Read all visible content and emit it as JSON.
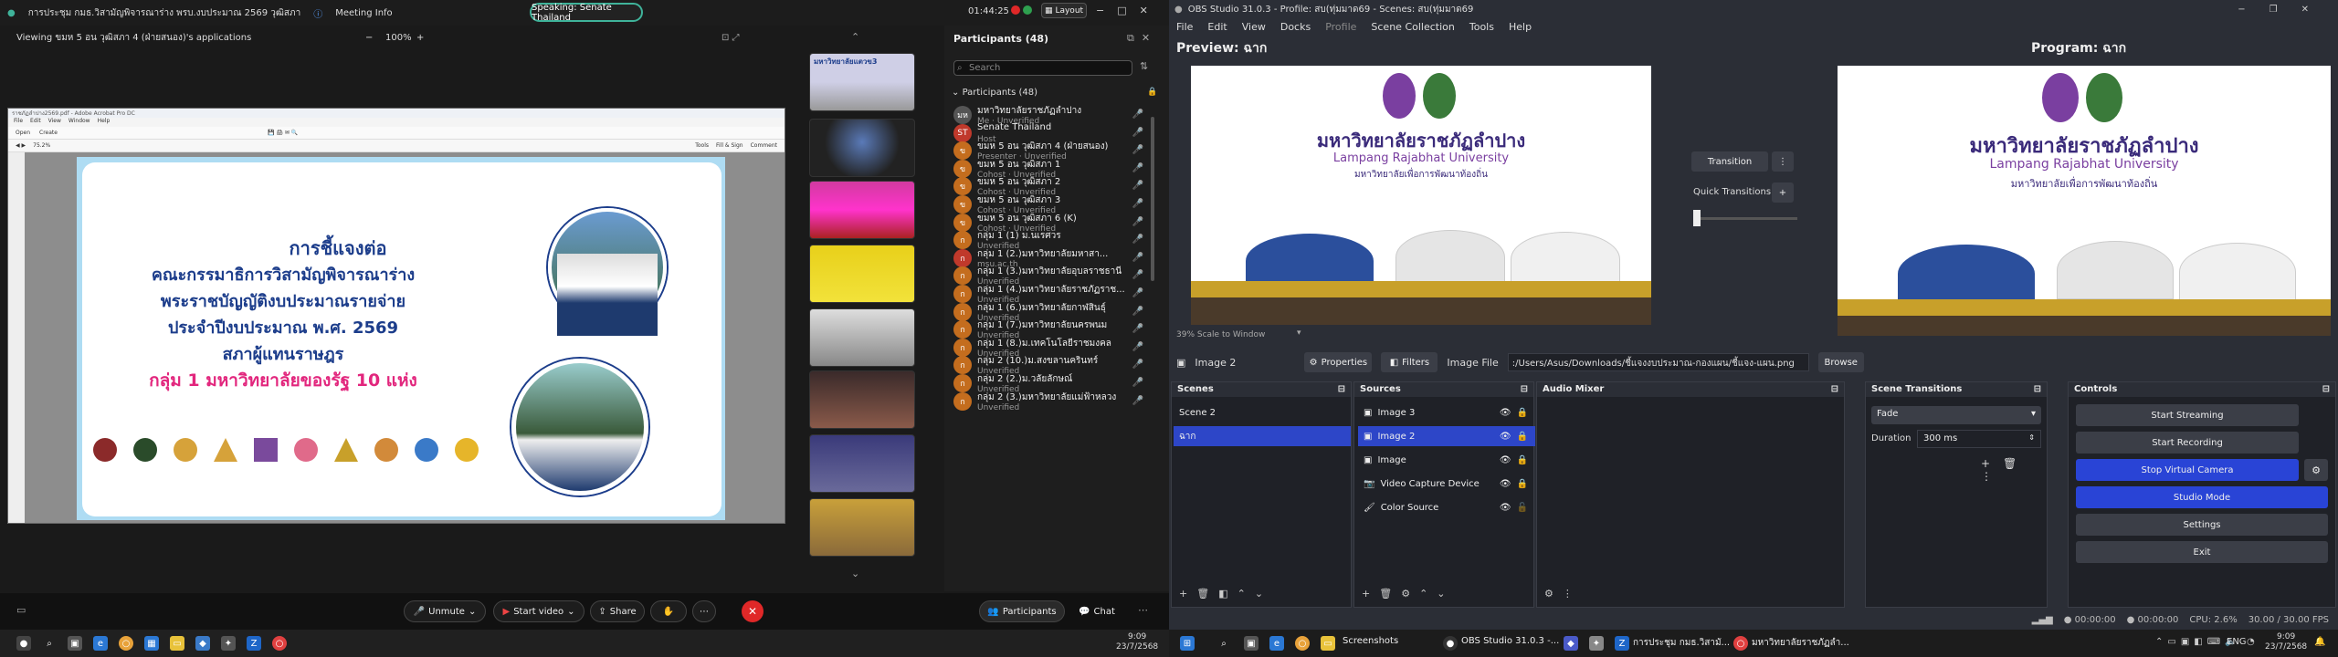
{
  "zoom": {
    "meeting_title": "การประชุม กมธ.วิสามัญพิจารณาร่าง พรบ.งบประมาณ 2569 วุฒิสภา",
    "meeting_info": "Meeting Info",
    "time": "01:44:25",
    "layout": "Layout",
    "speaking": "Speaking: Senate Thailand",
    "viewing": "Viewing ขมห 5 อน วุฒิสภา 4 (ฝ่ายสนอง)'s applications",
    "zoom_level": "100%",
    "minus": "−",
    "plus": "+",
    "slide": {
      "line1": "การชี้แจงต่อ",
      "line2": "คณะกรรมาธิการวิสามัญพิจารณาร่าง",
      "line3": "พระราชบัญญัติงบประมาณรายจ่าย",
      "line4": "ประจำปีงบประมาณ พ.ศ. 2569",
      "line5": "สภาผู้แทนราษฎร",
      "line6": "กลุ่ม 1 มหาวิทยาลัยของรัฐ 10 แห่ง"
    },
    "acrobat": {
      "menu": [
        "File",
        "Edit",
        "View",
        "Window",
        "Help"
      ],
      "open": "Open",
      "create": "Create",
      "zoom": "75.2%",
      "tools": "Tools",
      "fill_sign": "Fill & Sign",
      "comment": "Comment",
      "filename": "ราชภัฏลำปาง2569.pdf - Adobe Acrobat Pro DC"
    },
    "filmstrip_label": "มหาวิทยาลัยแตวข3",
    "participants": {
      "title": "Participants (48)",
      "search_placeholder": "Search",
      "group_label": "Participants (48)",
      "list": [
        {
          "name": "มหาวิทยาลัยราชภัฏลำปาง",
          "sub": "Me · Unverified",
          "avatar": "มห",
          "color": "#555"
        },
        {
          "name": "Senate Thailand",
          "sub": "Host",
          "avatar": "ST",
          "color": "#c0392b"
        },
        {
          "name": "ขมห 5 อน วุฒิสภา 4 (ฝ่ายสนอง)",
          "sub": "Presenter · Unverified",
          "avatar": "ข",
          "color": "#c46d1e"
        },
        {
          "name": "ขมห 5 อน วุฒิสภา 1",
          "sub": "Cohost · Unverified",
          "avatar": "ข",
          "color": "#c46d1e"
        },
        {
          "name": "ขมห 5 อน วุฒิสภา 2",
          "sub": "Cohost · Unverified",
          "avatar": "ข",
          "color": "#c46d1e"
        },
        {
          "name": "ขมห 5 อน วุฒิสภา 3",
          "sub": "Cohost · Unverified",
          "avatar": "ข",
          "color": "#c46d1e"
        },
        {
          "name": "ขมห 5 อน วุฒิสภา 6 (K)",
          "sub": "Cohost · Unverified",
          "avatar": "ข",
          "color": "#c46d1e"
        },
        {
          "name": "กลุ่ม 1 (1) ม.นเรศวร",
          "sub": "Unverified",
          "avatar": "ก",
          "color": "#c46d1e"
        },
        {
          "name": "กลุ่ม 1 (2.)มหาวิทยาลัยมหาสา...",
          "sub": "msu.ac.th",
          "avatar": "ก",
          "color": "#c0392b"
        },
        {
          "name": "กลุ่ม 1 (3.)มหาวิทยาลัยอุบลราชธานี",
          "sub": "Unverified",
          "avatar": "ก",
          "color": "#c46d1e"
        },
        {
          "name": "กลุ่ม 1 (4.)มหาวิทยาลัยราชภัฏราช...",
          "sub": "Unverified",
          "avatar": "ก",
          "color": "#c46d1e"
        },
        {
          "name": "กลุ่ม 1 (6.)มหาวิทยาลัยกาฬสินธุ์",
          "sub": "Unverified",
          "avatar": "ก",
          "color": "#c46d1e"
        },
        {
          "name": "กลุ่ม 1 (7.)มหาวิทยาลัยนครพนม",
          "sub": "Unverified",
          "avatar": "ก",
          "color": "#c46d1e"
        },
        {
          "name": "กลุ่ม 1 (8.)ม.เทคโนโลยีราชมงคล",
          "sub": "Unverified",
          "avatar": "ก",
          "color": "#c46d1e"
        },
        {
          "name": "กลุ่ม 2 (10.)ม.สงขลานครินทร์",
          "sub": "Unverified",
          "avatar": "ก",
          "color": "#c46d1e"
        },
        {
          "name": "กลุ่ม 2 (2.)ม.วลัยลักษณ์",
          "sub": "Unverified",
          "avatar": "ก",
          "color": "#c46d1e"
        },
        {
          "name": "กลุ่ม 2 (3.)มหาวิทยาลัยแม่ฟ้าหลวง",
          "sub": "Unverified",
          "avatar": "ก",
          "color": "#c46d1e"
        }
      ]
    },
    "bottom": {
      "unmute": "Unmute",
      "start_video": "Start video",
      "share": "Share",
      "participants": "Participants",
      "chat": "Chat"
    }
  },
  "obs": {
    "title": "OBS Studio 31.0.3 - Profile: สบ(ทุ่มมาด69 - Scenes: สบ(ทุ่มมาด69",
    "menu": [
      "File",
      "Edit",
      "View",
      "Docks",
      "Profile",
      "Scene Collection",
      "Tools",
      "Help"
    ],
    "preview_label": "Preview: ฉาก",
    "program_label": "Program: ฉาก",
    "scale": "39%  Scale to Window",
    "transition_btn": "Transition",
    "quick_transitions": "Quick Transitions",
    "banner_thai": "มหาวิทยาลัยราชภัฏลำปาง",
    "banner_en": "Lampang Rajabhat University",
    "banner_sub": "มหาวิทยาลัยเพื่อการพัฒนาท้องถิ่น",
    "source_bar": {
      "selected": "Image 2",
      "properties": "Properties",
      "filters": "Filters",
      "image_file_label": "Image File",
      "image_file_value": ":/Users/Asus/Downloads/ชี้แจงงบประมาณ-กองแผน/ชี้แจง-แผน.png",
      "browse": "Browse"
    },
    "scenes": {
      "title": "Scenes",
      "items": [
        "Scene 2",
        "ฉาก"
      ]
    },
    "sources": {
      "title": "Sources",
      "items": [
        "Image 3",
        "Image 2",
        "Image",
        "Video Capture Device",
        "Color Source"
      ]
    },
    "mixer": {
      "title": "Audio Mixer"
    },
    "transitions": {
      "title": "Scene Transitions",
      "type": "Fade",
      "duration_label": "Duration",
      "duration": "300 ms"
    },
    "controls": {
      "title": "Controls",
      "buttons": [
        "Start Streaming",
        "Start Recording",
        "Stop Virtual Camera",
        "Studio Mode",
        "Settings",
        "Exit"
      ]
    },
    "status": {
      "t1": "00:00:00",
      "t2": "00:00:00",
      "cpu": "CPU: 2.6%",
      "fps": "30.00 / 30.00 FPS"
    }
  },
  "taskbar": {
    "left_time": "9:09",
    "left_date": "23/7/2568",
    "right_items": [
      "Screenshots",
      "OBS Studio 31.0.3 -...",
      "การประชุม กมธ.วิสามั...",
      "มหาวิทยาลัยราชภัฏลำ..."
    ],
    "lang": "ENG",
    "right_time": "9:09",
    "right_date": "23/7/2568"
  },
  "colors": {
    "obs_blue": "#2944d6",
    "obs_selected": "#2d46c8",
    "zoom_red": "#e02828",
    "teal": "#3fb39a"
  }
}
